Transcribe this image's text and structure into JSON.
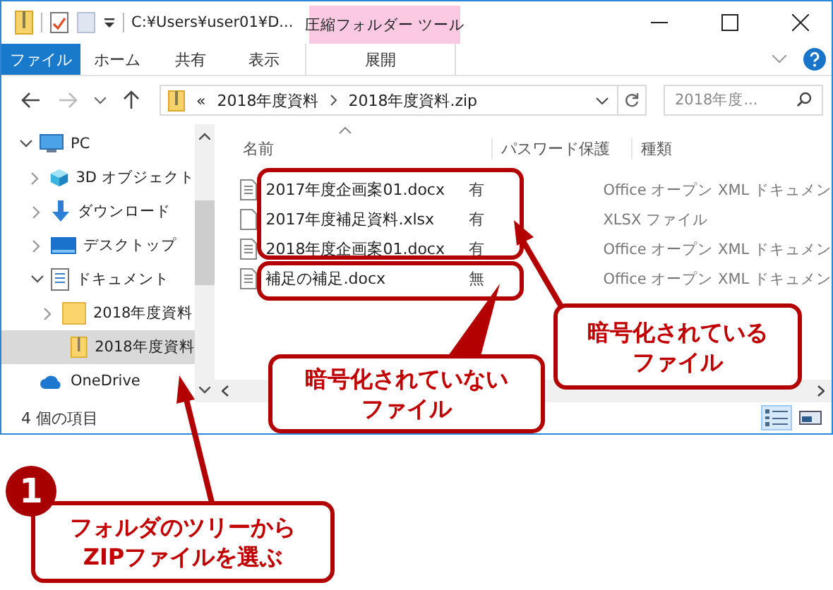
{
  "title_bar": {
    "path": "C:¥Users¥user01¥D...",
    "context_tab": "圧縮フォルダー ツール"
  },
  "ribbon_tabs": [
    {
      "label": "ファイル",
      "kind": "file"
    },
    {
      "label": "ホーム",
      "kind": "plain"
    },
    {
      "label": "共有",
      "kind": "plain"
    },
    {
      "label": "表示",
      "kind": "plain"
    },
    {
      "label": "展開",
      "kind": "context"
    }
  ],
  "address": {
    "overflow_mark": "«",
    "crumbs": [
      "2018年度資料",
      "2018年度資料.zip"
    ]
  },
  "search": {
    "placeholder": "2018年度..."
  },
  "nav": {
    "items": [
      {
        "label": "PC",
        "kind": "pc",
        "expanded": true,
        "selected": false,
        "children": [
          {
            "label": "3D オブジェクト",
            "kind": "objects3d",
            "expanded": false,
            "selected": false
          },
          {
            "label": "ダウンロード",
            "kind": "downloads",
            "expanded": false,
            "selected": false
          },
          {
            "label": "デスクトップ",
            "kind": "desktop",
            "expanded": false,
            "selected": false
          },
          {
            "label": "ドキュメント",
            "kind": "documents",
            "expanded": true,
            "selected": false,
            "children": [
              {
                "label": "2018年度資料",
                "kind": "folder",
                "expanded": false,
                "selected": false,
                "children": [
                  {
                    "label": "2018年度資料",
                    "kind": "zip",
                    "selected": true
                  }
                ]
              }
            ]
          }
        ]
      },
      {
        "label": "OneDrive",
        "kind": "onedrive",
        "selected": false
      }
    ]
  },
  "columns": [
    "名前",
    "パスワード保護",
    "種類"
  ],
  "files": [
    {
      "name": "2017年度企画案01.docx",
      "protection": "有",
      "type": "Office オープン XML ドキュメン",
      "kind": "docx"
    },
    {
      "name": "2017年度補足資料.xlsx",
      "protection": "有",
      "type": "XLSX ファイル",
      "kind": "xlsx"
    },
    {
      "name": "2018年度企画案01.docx",
      "protection": "有",
      "type": "Office オープン XML ドキュメン",
      "kind": "docx"
    },
    {
      "name": "補足の補足.docx",
      "protection": "無",
      "type": "Office オープン XML ドキュメン",
      "kind": "docx"
    }
  ],
  "status_bar": {
    "count": "4 個の項目",
    "views": [
      {
        "kind": "details",
        "selected": true
      },
      {
        "kind": "large",
        "selected": false
      }
    ]
  },
  "callouts": [
    {
      "lines": [
        "暗号化されている",
        "ファイル"
      ]
    },
    {
      "lines": [
        "暗号化されていない",
        "ファイル"
      ]
    },
    {
      "step": "1",
      "lines": [
        "フォルダのツリーから",
        "ZIPファイルを選ぶ"
      ]
    }
  ]
}
